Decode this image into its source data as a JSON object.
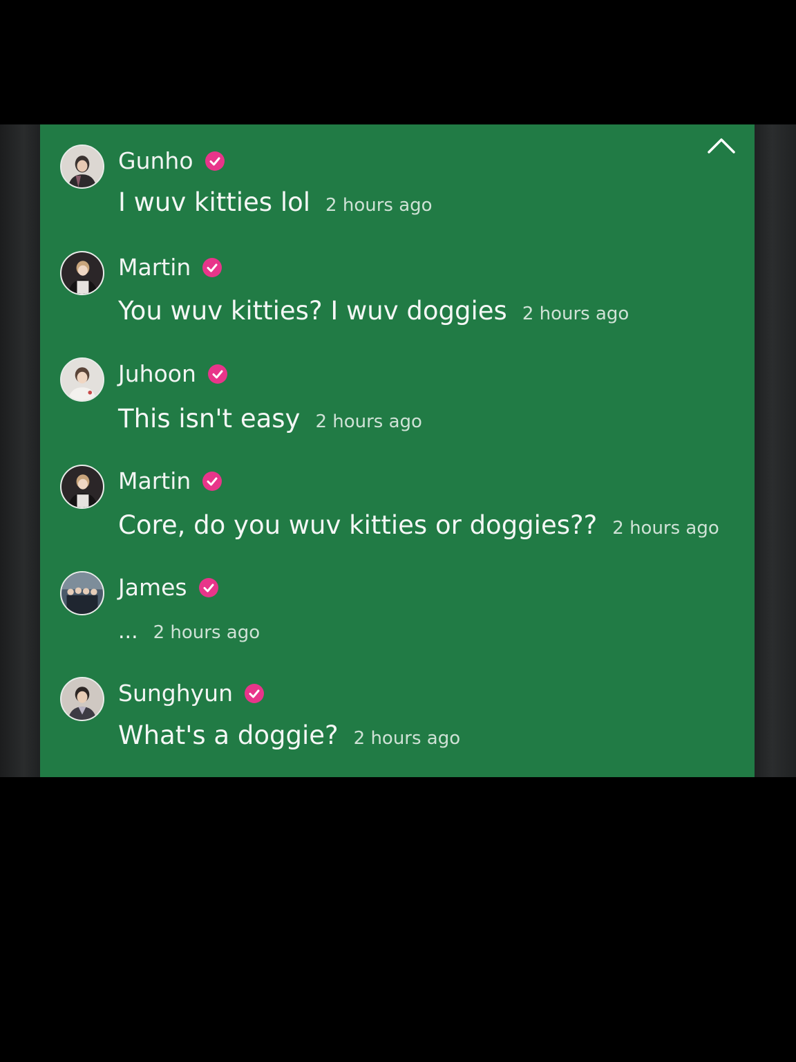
{
  "colors": {
    "panel_bg": "#217b45",
    "verified_badge": "#e8358a",
    "text": "#f4f7f5",
    "timestamp": "#cfe2d6"
  },
  "header": {
    "collapse_icon": "chevron-up-icon"
  },
  "comments": [
    {
      "author": "Gunho",
      "verified": true,
      "text": "I wuv kitties lol",
      "time": "2 hours ago"
    },
    {
      "author": "Martin",
      "verified": true,
      "text": "You wuv kitties? I wuv doggies",
      "time": "2 hours ago"
    },
    {
      "author": "Juhoon",
      "verified": true,
      "text": "This isn't easy",
      "time": "2 hours ago"
    },
    {
      "author": "Martin",
      "verified": true,
      "text": "Core, do you wuv kitties or doggies??",
      "time": "2 hours ago"
    },
    {
      "author": "James",
      "verified": true,
      "text": "...",
      "time": "2 hours ago"
    },
    {
      "author": "Sunghyun",
      "verified": true,
      "text": "What's a doggie?",
      "time": "2 hours ago"
    }
  ]
}
